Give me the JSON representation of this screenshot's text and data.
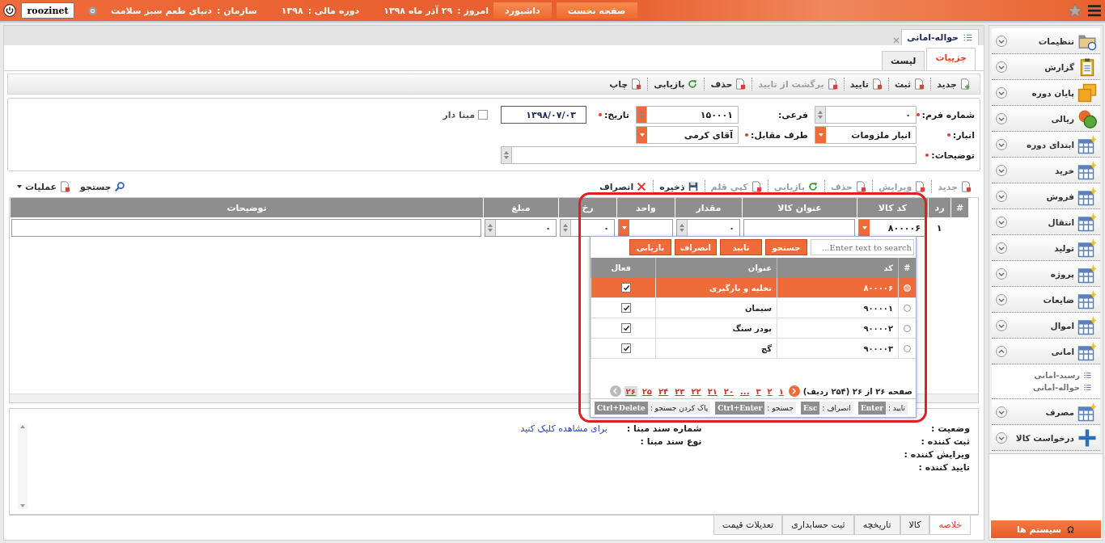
{
  "top_bar": {
    "home_button": "صفحه نخست",
    "dashboard_button": "داشبورد",
    "today_label": "امروز :",
    "today": "۲۹ آذر ماه ۱۳۹۸",
    "fiscal_label": "دوره مالی :",
    "fiscal": "۱۳۹۸",
    "org_label": "سازمان :",
    "org": "دنیای طعم سبز سلامت",
    "user": "roozinet"
  },
  "sidebar": {
    "items": [
      {
        "label": "تنظیمات",
        "expanded": false
      },
      {
        "label": "گزارش",
        "expanded": false
      },
      {
        "label": "پایان دوره",
        "expanded": false
      },
      {
        "label": "ریالی",
        "expanded": false
      },
      {
        "label": "ابتدای دوره",
        "expanded": false
      },
      {
        "label": "خرید",
        "expanded": false
      },
      {
        "label": "فروش",
        "expanded": false
      },
      {
        "label": "انتقال",
        "expanded": false
      },
      {
        "label": "تولید",
        "expanded": false
      },
      {
        "label": "پروژه",
        "expanded": false
      },
      {
        "label": "ضایعات",
        "expanded": false
      },
      {
        "label": "اموال",
        "expanded": false
      },
      {
        "label": "امانی",
        "expanded": true,
        "children": [
          {
            "label": "رسید-امانی"
          },
          {
            "label": "حواله-امانی"
          }
        ]
      },
      {
        "label": "مصرف",
        "expanded": false
      },
      {
        "label": "درخواست کالا",
        "expanded": false
      }
    ],
    "footer_button": "سیستم ها"
  },
  "document_tab": {
    "title": "حواله-امانی"
  },
  "view_tabs": [
    {
      "label": "جزییات",
      "selected": true
    },
    {
      "label": "لیست",
      "selected": false
    }
  ],
  "toolbar": [
    {
      "label": "جدید",
      "disabled": false
    },
    {
      "label": "ثبت",
      "disabled": false
    },
    {
      "label": "تایید",
      "disabled": false
    },
    {
      "label": "برگشت از تایید",
      "disabled": true
    },
    {
      "label": "حذف",
      "disabled": false
    },
    {
      "label": "بازیابی",
      "disabled": false
    },
    {
      "label": "چاپ",
      "disabled": false
    }
  ],
  "form": {
    "fields": [
      {
        "kind": "spinner",
        "label": "شماره فرم:",
        "required": true,
        "value": "۰"
      },
      {
        "kind": "spinner",
        "label": "فرعی:",
        "required": false,
        "value": "۱۵۰۰۰۱"
      },
      {
        "kind": "date",
        "label": "تاریخ:",
        "required": true,
        "value": "۱۳۹۸/۰۷/۰۳"
      },
      {
        "kind": "checkbox",
        "label": "مبنا دار",
        "checked": false
      },
      {
        "kind": "combo",
        "label": "انبار:",
        "required": true,
        "value": "انبار ملزومات"
      },
      {
        "kind": "combo",
        "label": "طرف مقابل:",
        "required": true,
        "value": "آقای  کرمی"
      },
      {
        "kind": "memo",
        "label": "توضیحات:",
        "required": true
      }
    ]
  },
  "grid_toolbar": {
    "right": [
      {
        "label": "جدید",
        "disabled": true
      },
      {
        "label": "ویرایش",
        "disabled": true
      },
      {
        "label": "حذف",
        "disabled": true
      },
      {
        "label": "بازیابی",
        "disabled": true
      },
      {
        "label": "کپی قلم",
        "disabled": true
      },
      {
        "label": "ذخیره",
        "disabled": false
      },
      {
        "label": "انصراف",
        "disabled": false
      }
    ],
    "left": [
      {
        "label": "جستجو"
      },
      {
        "label": "عملیات"
      }
    ]
  },
  "grid": {
    "columns": [
      "#",
      "رد",
      "کد کالا",
      "عنوان کالا",
      "مقدار",
      "واحد",
      "رخ",
      "مبلغ",
      "توضیحات"
    ],
    "rows": [
      {
        "row": "۱",
        "code": "۸۰۰۰۰۶",
        "quantity": "۰",
        "rate": "۰",
        "amount": "۰"
      }
    ]
  },
  "popup": {
    "search_placeholder": "Enter text to search...",
    "buttons": [
      "جستجو",
      "تایید",
      "انصراف",
      "بازیابی"
    ],
    "columns": [
      "#",
      "کد",
      "عنوان",
      "فعال"
    ],
    "rows": [
      {
        "code": "۸۰۰۰۰۶",
        "title": "تخلیه و بارگیری",
        "active": true,
        "selected": true
      },
      {
        "code": "۹۰۰۰۰۱",
        "title": "سیمان",
        "active": true,
        "selected": false
      },
      {
        "code": "۹۰۰۰۰۲",
        "title": "پودر سنگ",
        "active": true,
        "selected": false
      },
      {
        "code": "۹۰۰۰۰۳",
        "title": "گچ",
        "active": true,
        "selected": false
      }
    ],
    "page_info": "صفحه ۲۶ از ۲۶ (۲۵۴ ردیف)",
    "pages": [
      {
        "label": "۱",
        "selected": false
      },
      {
        "label": "۲",
        "selected": false
      },
      {
        "label": "۳",
        "selected": false
      },
      {
        "label": "...",
        "selected": false
      },
      {
        "label": "۲۰",
        "selected": false
      },
      {
        "label": "۲۱",
        "selected": false
      },
      {
        "label": "۲۲",
        "selected": false
      },
      {
        "label": "۲۳",
        "selected": false
      },
      {
        "label": "۲۴",
        "selected": false
      },
      {
        "label": "۲۵",
        "selected": false
      },
      {
        "label": "۲۶",
        "selected": true
      }
    ],
    "shortcuts": [
      {
        "label": "تایید :",
        "key": "Enter"
      },
      {
        "label": "انصراف :",
        "key": "Esc"
      },
      {
        "label": "جستجو :",
        "key": "Ctrl+Enter"
      },
      {
        "label": "پاک کردن جستجو :",
        "key": "Ctrl+Delete"
      }
    ]
  },
  "info": {
    "right_labels": [
      "وضعیت :",
      "ثبت کننده :",
      "ویرایش کننده :",
      "تایید کننده :"
    ],
    "middle_labels": [
      "شماره سند مبنا :",
      "نوع سند مبنا :"
    ],
    "link": "برای مشاهده کلیک کنید"
  },
  "bottom_tabs": [
    {
      "label": "خلاصه",
      "selected": true
    },
    {
      "label": "کالا",
      "selected": false
    },
    {
      "label": "تاریخچه",
      "selected": false
    },
    {
      "label": "ثبت حسابداری",
      "selected": false
    },
    {
      "label": "تعدیلات قیمت",
      "selected": false
    }
  ]
}
